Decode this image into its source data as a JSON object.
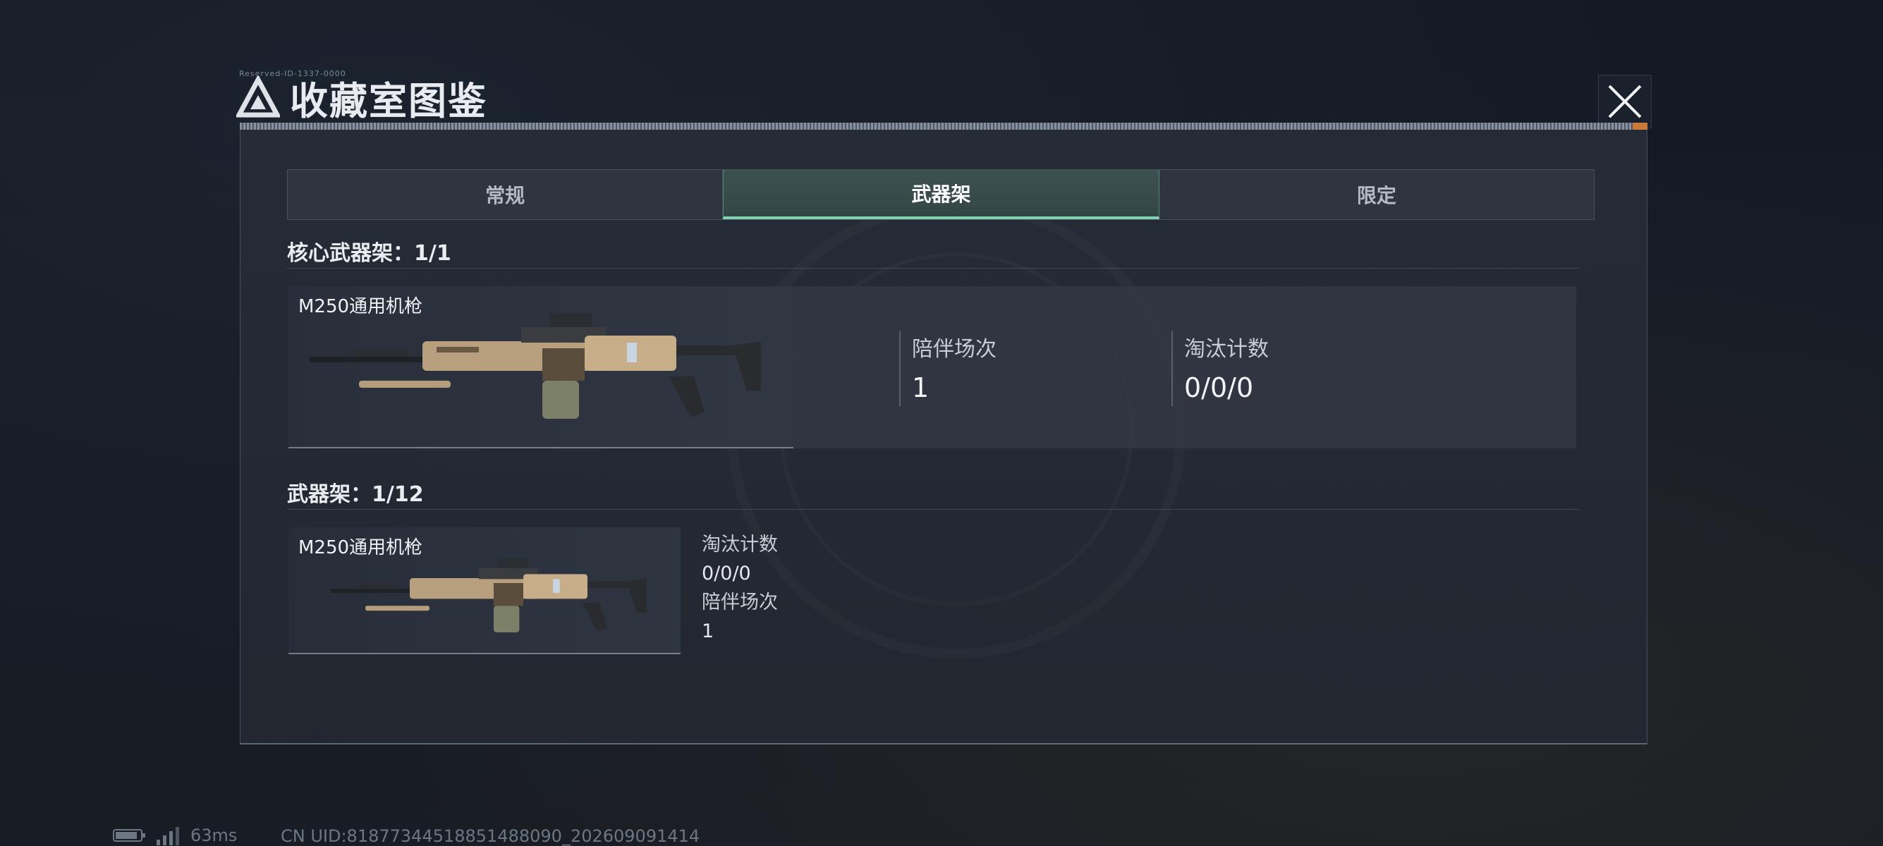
{
  "window": {
    "title": "收藏室图鉴",
    "mini_caption": "Reserved-ID-1337-0000"
  },
  "tabs": [
    {
      "label": "常规",
      "active": false
    },
    {
      "label": "武器架",
      "active": true
    },
    {
      "label": "限定",
      "active": false
    }
  ],
  "core_rack": {
    "heading": "核心武器架：1/1",
    "item": {
      "name": "M250通用机枪",
      "stats": [
        {
          "label": "陪伴场次",
          "value": "1"
        },
        {
          "label": "淘汰计数",
          "value": "0/0/0"
        }
      ]
    }
  },
  "weapon_rack": {
    "heading": "武器架：1/12",
    "item": {
      "name": "M250通用机枪",
      "elim_label": "淘汰计数",
      "elim_value": "0/0/0",
      "matches_label": "陪伴场次",
      "matches_value": "1"
    }
  },
  "status_bar": {
    "ping": "63ms",
    "uid": "CN UID:81877344518851488090_202609091414"
  },
  "colors": {
    "accent": "#7fd3b1",
    "panel": "#262c37",
    "background": "#121722"
  }
}
